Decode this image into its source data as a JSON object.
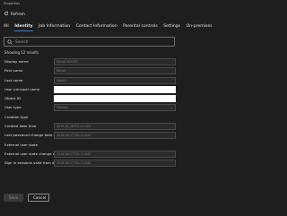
{
  "window": {
    "title": "Properties"
  },
  "toolbar": {
    "refresh_label": "Refresh"
  },
  "tabs": [
    {
      "label": "All",
      "active": false
    },
    {
      "label": "Identity",
      "active": true
    },
    {
      "label": "Job Information",
      "active": false
    },
    {
      "label": "Contact Information",
      "active": false
    },
    {
      "label": "Parental controls",
      "active": false
    },
    {
      "label": "Settings",
      "active": false
    },
    {
      "label": "On-premises",
      "active": false
    }
  ],
  "search": {
    "placeholder": "Search",
    "value": ""
  },
  "results": {
    "text": "Showing 12 results"
  },
  "fields": [
    {
      "label": "Display name",
      "value": "Benoit 849487"
    },
    {
      "label": "First name",
      "value": "Benoit"
    },
    {
      "label": "Last name",
      "value": "4eb4f5"
    },
    {
      "label": "User principal name",
      "value": ""
    },
    {
      "label": "Object ID",
      "value": ""
    },
    {
      "label": "User type",
      "value": "Member"
    },
    {
      "label": "Creation type",
      "value": ""
    },
    {
      "label": "Created date time",
      "value": "2018-01-16T21:13:42Z"
    },
    {
      "label": "Last password change date time",
      "value": "2018-06-17T20:12:04Z"
    },
    {
      "label": "External user state",
      "value": ""
    },
    {
      "label": "External user state change date time",
      "value": "2018-06-17T20:12:04Z"
    },
    {
      "label": "Sign in sessions valid from date time",
      "value": "2018-06-17T20:12:04Z"
    }
  ],
  "buttons": {
    "save": "Save",
    "cancel": "Cancel"
  },
  "colors": {
    "background": "#1e1e1e",
    "accent": "#2f7fd8",
    "text": "#e6e6e6",
    "field_bg": "#2a2a2a"
  }
}
